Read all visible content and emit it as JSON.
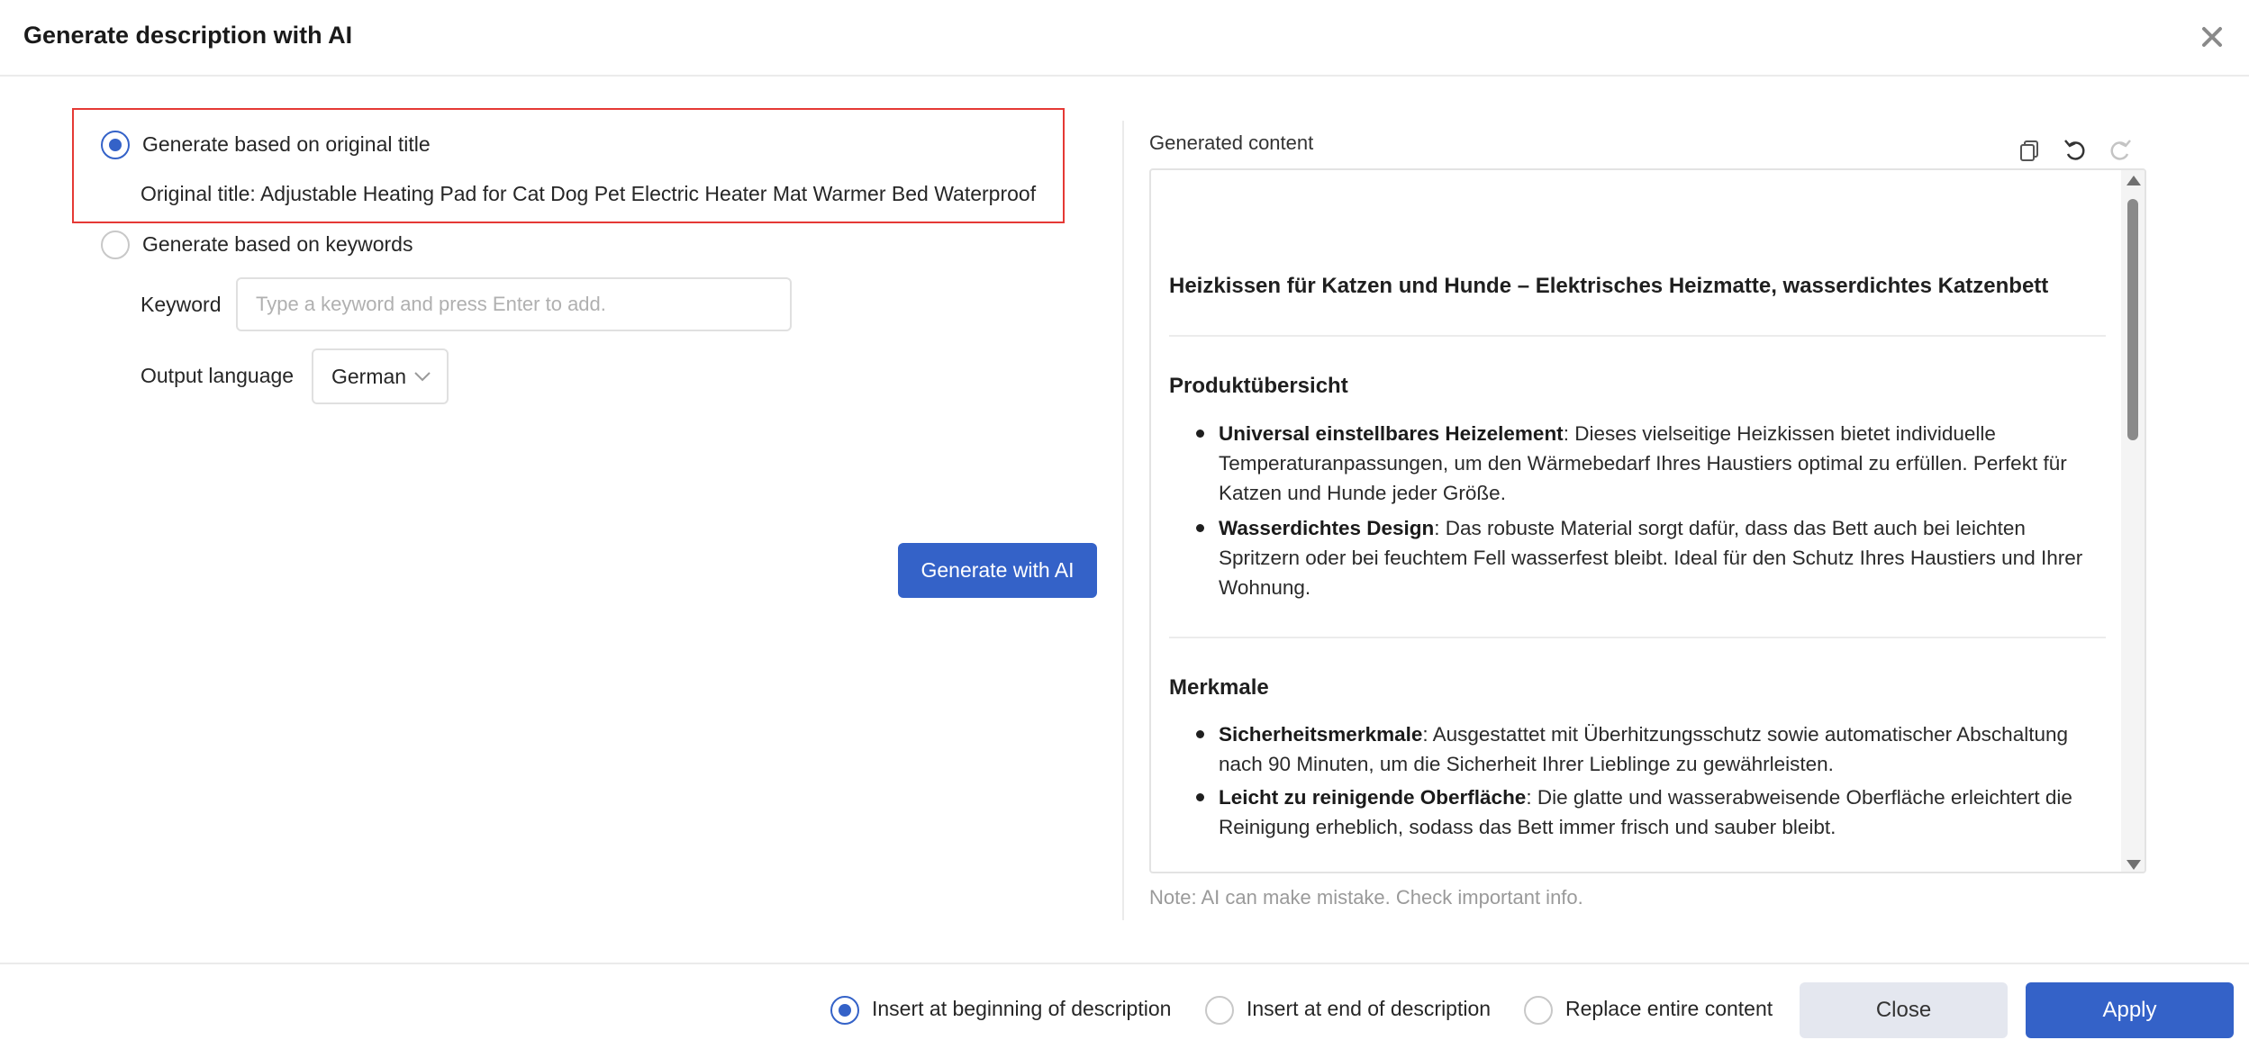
{
  "dialog": {
    "title": "Generate description with AI"
  },
  "left": {
    "option_title_label": "Generate based on original title",
    "original_title": "Original title: Adjustable Heating Pad for Cat Dog Pet Electric Heater Mat Warmer Bed Waterproof",
    "option_keywords_label": "Generate based on keywords",
    "keyword_label": "Keyword",
    "keyword_placeholder": "Type a keyword and press Enter to add.",
    "keyword_value": "",
    "output_language_label": "Output language",
    "output_language_value": "German",
    "generate_button": "Generate with AI",
    "selected_option": "original_title"
  },
  "right": {
    "label": "Generated content",
    "content": {
      "heading": "Heizkissen für Katzen und Hunde – Elektrisches Heizmatte, wasserdichtes Katzenbett",
      "section1_title": "Produktübersicht",
      "bullets1": [
        {
          "bold": "Universal einstellbares Heizelement",
          "text": ": Dieses vielseitige Heizkissen bietet individuelle Temperaturanpassungen, um den Wärmebedarf Ihres Haustiers optimal zu erfüllen. Perfekt für Katzen und Hunde jeder Größe."
        },
        {
          "bold": "Wasserdichtes Design",
          "text": ": Das robuste Material sorgt dafür, dass das Bett auch bei leichten Spritzern oder bei feuchtem Fell wasserfest bleibt. Ideal für den Schutz Ihres Haustiers und Ihrer Wohnung."
        }
      ],
      "section2_title": "Merkmale",
      "bullets2": [
        {
          "bold": "Sicherheitsmerkmale",
          "text": ": Ausgestattet mit Überhitzungsschutz sowie automatischer Abschaltung nach 90 Minuten, um die Sicherheit Ihrer Lieblinge zu gewährleisten."
        },
        {
          "bold": "Leicht zu reinigende Oberfläche",
          "text": ": Die glatte und wasserabweisende Oberfläche erleichtert die Reinigung erheblich, sodass das Bett immer frisch und sauber bleibt."
        }
      ]
    },
    "note": "Note: AI can make mistake. Check important info."
  },
  "footer": {
    "insert_beginning_label": "Insert at beginning of description",
    "insert_end_label": "Insert at end of description",
    "replace_label": "Replace entire content",
    "selected_insert": "beginning",
    "close_button": "Close",
    "apply_button": "Apply"
  },
  "colors": {
    "accent": "#3462c8",
    "highlight_border": "#e53935"
  }
}
